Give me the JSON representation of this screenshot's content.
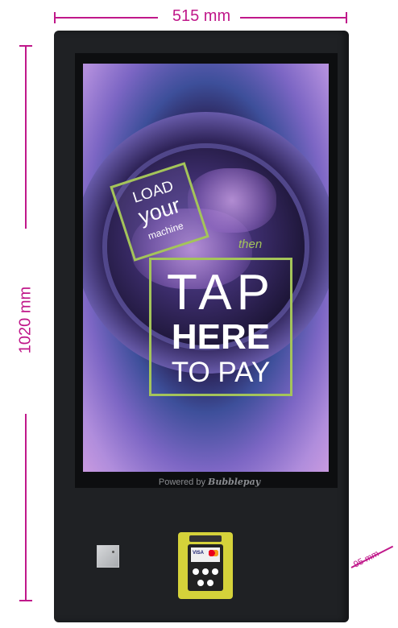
{
  "dimensions": {
    "width_label": "515 mm",
    "height_label": "1020 mm",
    "depth_label": "95 mm"
  },
  "screen": {
    "load_line1": "LOAD",
    "load_line2": "your",
    "load_line3": "machine",
    "then": "then",
    "tap": "TAP",
    "here": "HERE",
    "to_pay": "TO PAY"
  },
  "footer": {
    "powered_prefix": "Powered by",
    "powered_brand": "Bubblepay"
  },
  "terminal": {
    "card_brand": "VISA"
  },
  "colors": {
    "dimension": "#c0188a",
    "accent": "#a4c45a",
    "kiosk_body": "#1f2124",
    "terminal": "#d5d23a"
  }
}
